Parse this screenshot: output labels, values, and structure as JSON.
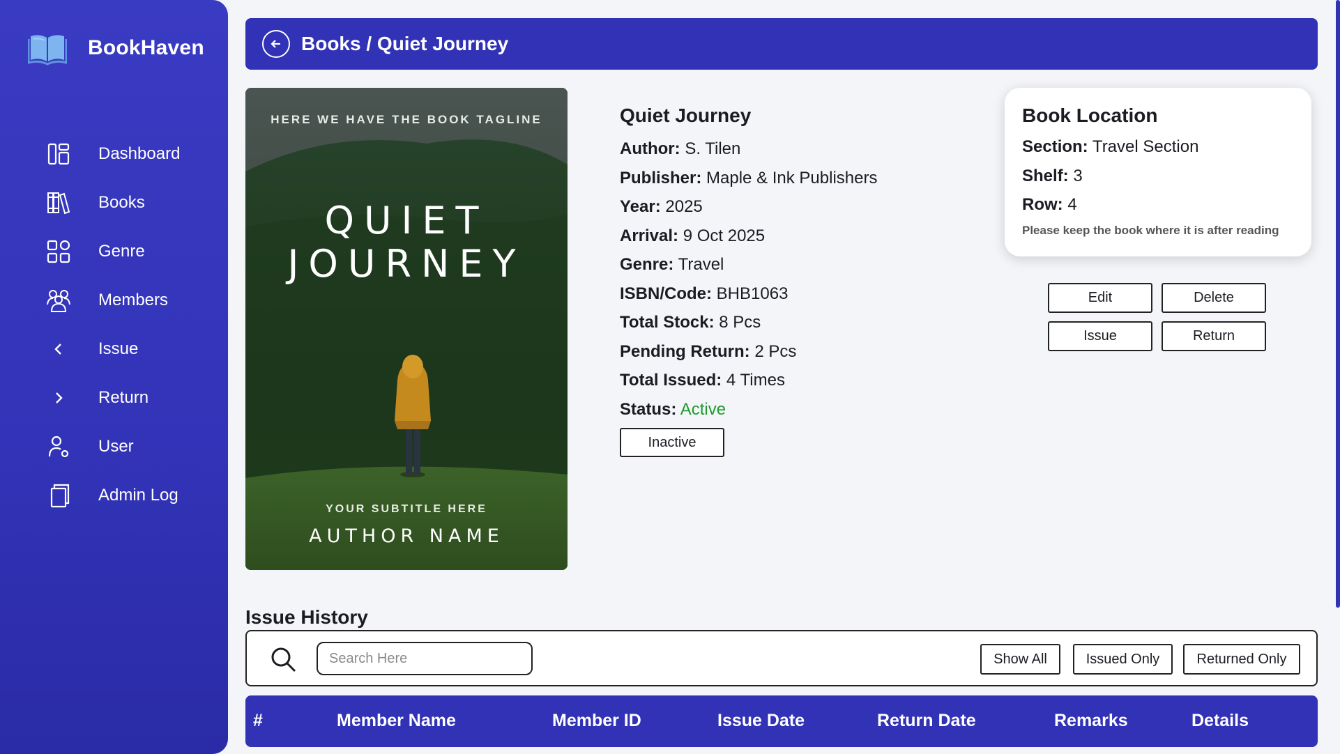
{
  "brand": {
    "name": "BookHaven",
    "logo_icon": "open-book-icon"
  },
  "sidebar": {
    "items": [
      {
        "label": "Dashboard",
        "icon": "dashboard-icon"
      },
      {
        "label": "Books",
        "icon": "books-icon"
      },
      {
        "label": "Genre",
        "icon": "grid-icon"
      },
      {
        "label": "Members",
        "icon": "members-icon"
      },
      {
        "label": "Issue",
        "icon": "chevron-left-icon"
      },
      {
        "label": "Return",
        "icon": "chevron-right-icon"
      },
      {
        "label": "User",
        "icon": "user-icon"
      },
      {
        "label": "Admin Log",
        "icon": "copy-icon"
      }
    ]
  },
  "header": {
    "breadcrumb": "Books / Quiet Journey",
    "back_icon": "arrow-left-circle-icon"
  },
  "cover": {
    "tagline": "HERE WE HAVE THE BOOK TAGLINE",
    "title_line1": "QUIET",
    "title_line2": "JOURNEY",
    "subtitle": "YOUR SUBTITLE HERE",
    "author": "AUTHOR NAME"
  },
  "book": {
    "title": "Quiet Journey",
    "fields": [
      {
        "label": "Author:",
        "value": "S. Tilen"
      },
      {
        "label": "Publisher:",
        "value": "Maple & Ink Publishers"
      },
      {
        "label": "Year:",
        "value": "2025"
      },
      {
        "label": "Arrival:",
        "value": "9 Oct 2025"
      },
      {
        "label": "Genre:",
        "value": "Travel"
      },
      {
        "label": "ISBN/Code:",
        "value": "BHB1063"
      },
      {
        "label": "Total Stock:",
        "value": "8 Pcs"
      },
      {
        "label": "Pending Return:",
        "value": "2 Pcs"
      },
      {
        "label": "Total Issued:",
        "value": "4 Times"
      }
    ],
    "status_label": "Status:",
    "status_value": "Active",
    "status_color": "#1f9a2d",
    "toggle_button": "Inactive"
  },
  "location": {
    "title": "Book Location",
    "section_label": "Section:",
    "section_value": "Travel Section",
    "shelf_label": "Shelf:",
    "shelf_value": "3",
    "row_label": "Row:",
    "row_value": "4",
    "note": "Please keep the book where it is after reading"
  },
  "actions": {
    "edit": "Edit",
    "delete": "Delete",
    "issue": "Issue",
    "return": "Return"
  },
  "issue_history": {
    "title": "Issue History",
    "search_placeholder": "Search Here",
    "filters": {
      "show_all": "Show All",
      "issued_only": "Issued Only",
      "returned_only": "Returned Only"
    },
    "columns": [
      "#",
      "Member Name",
      "Member ID",
      "Issue Date",
      "Return Date",
      "Remarks",
      "Details"
    ]
  },
  "colors": {
    "primary": "#3132b6",
    "background": "#f4f5f9"
  }
}
